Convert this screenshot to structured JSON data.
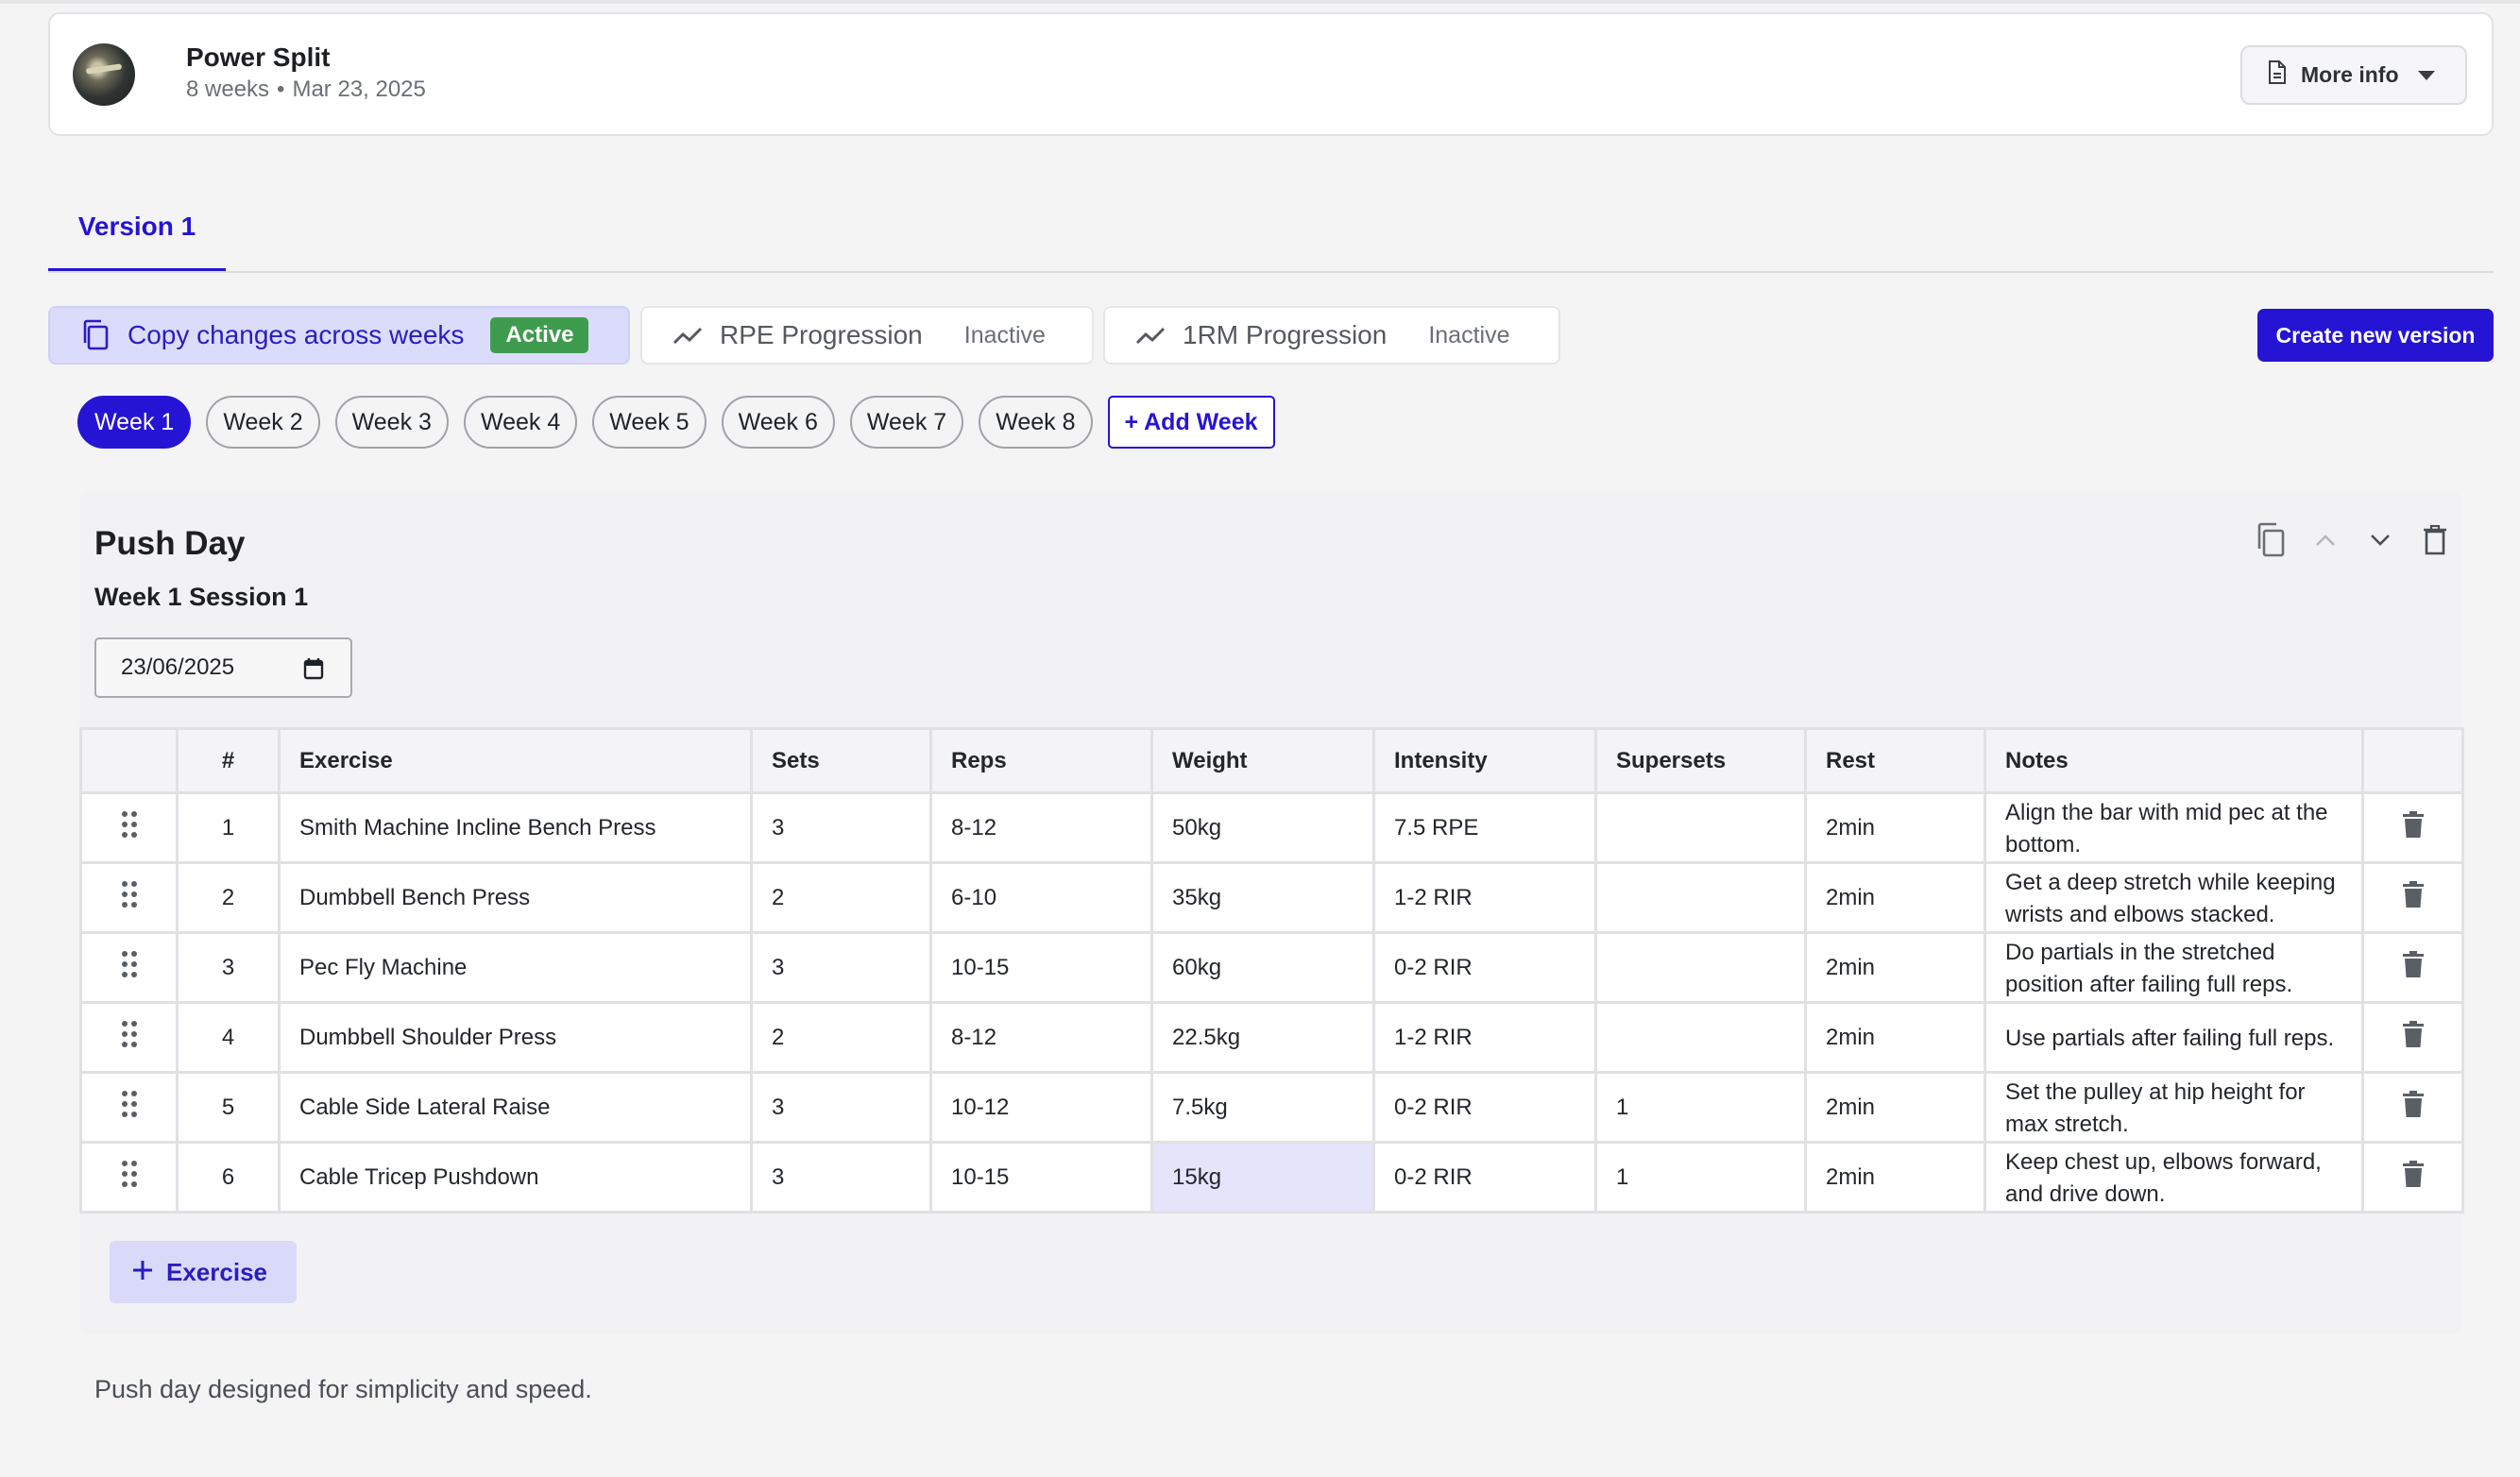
{
  "program": {
    "title": "Power Split",
    "duration": "8 weeks",
    "separator": "•",
    "date": "Mar 23, 2025",
    "more_info_label": "More info"
  },
  "version_tab": {
    "label": "Version 1"
  },
  "toggles": {
    "copy": {
      "label": "Copy changes across weeks",
      "status": "Active"
    },
    "rpe": {
      "label": "RPE Progression",
      "status": "Inactive"
    },
    "onerm": {
      "label": "1RM Progression",
      "status": "Inactive"
    }
  },
  "create_version_label": "Create new version",
  "weeks": {
    "items": [
      "Week 1",
      "Week 2",
      "Week 3",
      "Week 4",
      "Week 5",
      "Week 6",
      "Week 7",
      "Week 8"
    ],
    "active": "Week 1",
    "add_label": "+ Add Week"
  },
  "session": {
    "title": "Push Day",
    "subtitle": "Week 1 Session 1",
    "date_value": "23/06/2025",
    "description": "Push day designed for simplicity and speed.",
    "add_exercise_label": "Exercise"
  },
  "table": {
    "headers": [
      "",
      "#",
      "Exercise",
      "Sets",
      "Reps",
      "Weight",
      "Intensity",
      "Supersets",
      "Rest",
      "Notes",
      ""
    ],
    "rows": [
      {
        "num": "1",
        "exercise": "Smith Machine Incline Bench Press",
        "sets": "3",
        "reps": "8-12",
        "weight": "50kg",
        "intensity": "7.5 RPE",
        "supersets": "",
        "rest": "2min",
        "notes": "Align the bar with mid pec at the bottom."
      },
      {
        "num": "2",
        "exercise": "Dumbbell Bench Press",
        "sets": "2",
        "reps": "6-10",
        "weight": "35kg",
        "intensity": "1-2 RIR",
        "supersets": "",
        "rest": "2min",
        "notes": "Get a deep stretch while keeping wrists and elbows stacked."
      },
      {
        "num": "3",
        "exercise": "Pec Fly Machine",
        "sets": "3",
        "reps": "10-15",
        "weight": "60kg",
        "intensity": "0-2 RIR",
        "supersets": "",
        "rest": "2min",
        "notes": "Do partials in the stretched position after failing full reps."
      },
      {
        "num": "4",
        "exercise": "Dumbbell Shoulder Press",
        "sets": "2",
        "reps": "8-12",
        "weight": "22.5kg",
        "intensity": "1-2 RIR",
        "supersets": "",
        "rest": "2min",
        "notes": "Use partials after failing full reps."
      },
      {
        "num": "5",
        "exercise": "Cable Side Lateral Raise",
        "sets": "3",
        "reps": "10-12",
        "weight": "7.5kg",
        "intensity": "0-2 RIR",
        "supersets": "1",
        "rest": "2min",
        "notes": "Set the pulley at hip height for max stretch."
      },
      {
        "num": "6",
        "exercise": "Cable Tricep Pushdown",
        "sets": "3",
        "reps": "10-15",
        "weight": "15kg",
        "intensity": "0-2 RIR",
        "supersets": "1",
        "rest": "2min",
        "notes": "Keep chest up, elbows forward, and drive down."
      }
    ]
  },
  "colors": {
    "primary": "#2614d4",
    "active_badge": "#3f9c4f",
    "copy_toggle_bg": "#dbdcfb",
    "selected_cell": "#e4e4fb"
  },
  "icons": {
    "more_info": "document-icon",
    "copy": "copy-icon",
    "progression": "trend-line-icon",
    "calendar": "calendar-icon",
    "drag": "drag-handle-icon",
    "delete": "trash-icon"
  }
}
